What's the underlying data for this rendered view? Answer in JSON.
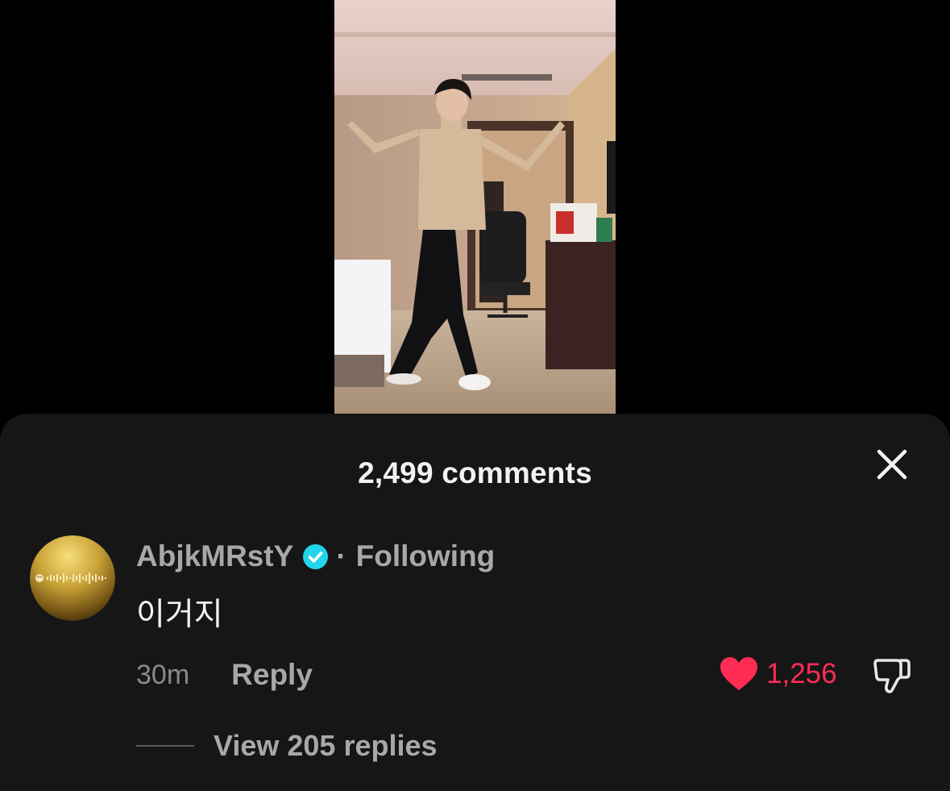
{
  "video": {
    "description_icon": "dancing-person-video"
  },
  "sheet": {
    "title": "2,499 comments",
    "close_icon": "close-icon"
  },
  "comment": {
    "avatar_icon": "gold-spotify-code-avatar",
    "username": "AbjkMRstY",
    "verified_icon": "verified-badge-icon",
    "separator": "·",
    "follow_status": "Following",
    "text": "이거지",
    "timestamp": "30m",
    "reply_label": "Reply",
    "like_icon": "heart-icon",
    "like_count": "1,256",
    "dislike_icon": "thumbs-down-icon",
    "view_replies_label": "View 205 replies"
  },
  "colors": {
    "background": "#000000",
    "sheet": "#161616",
    "primary_text": "#f2f2f2",
    "secondary_text": "#a8a8a8",
    "like_red": "#fe2c55",
    "verified_blue": "#20d5ec"
  }
}
